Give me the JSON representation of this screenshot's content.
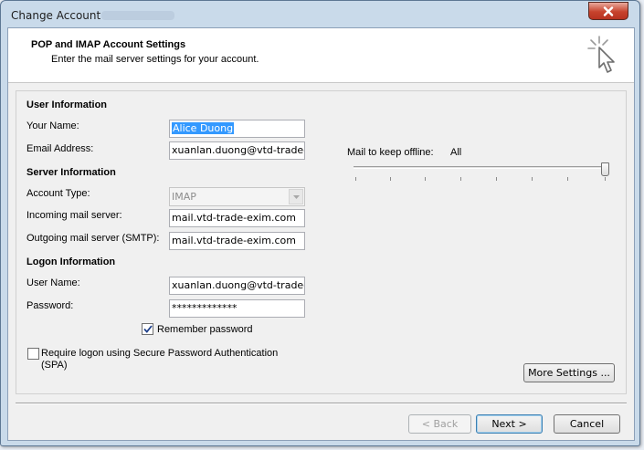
{
  "window": {
    "title": "Change Account",
    "close_icon": "close-icon"
  },
  "header": {
    "title": "POP and IMAP Account Settings",
    "subtitle": "Enter the mail server settings for your account.",
    "icon": "wizard-cursor-icon"
  },
  "user_info": {
    "section_label": "User Information",
    "name_label": "Your Name:",
    "name_value": "Alice Duong",
    "email_label": "Email Address:",
    "email_value": "xuanlan.duong@vtd-trade-e"
  },
  "server_info": {
    "section_label": "Server Information",
    "account_type_label": "Account Type:",
    "account_type_value": "IMAP",
    "incoming_label": "Incoming mail server:",
    "incoming_value": "mail.vtd-trade-exim.com",
    "outgoing_label": "Outgoing mail server (SMTP):",
    "outgoing_value": "mail.vtd-trade-exim.com"
  },
  "logon_info": {
    "section_label": "Logon Information",
    "username_label": "User Name:",
    "username_value": "xuanlan.duong@vtd-trade-e",
    "password_label": "Password:",
    "password_value": "*************",
    "remember_label": "Remember password",
    "remember_checked": true,
    "spa_label_line1": "Require logon using Secure Password Authentication",
    "spa_label_line2": "(SPA)",
    "spa_checked": false
  },
  "offline": {
    "label": "Mail to keep offline:",
    "value": "All",
    "level_fraction": 1.0
  },
  "buttons": {
    "more_settings": "More Settings ...",
    "back": "< Back",
    "next": "Next >",
    "cancel": "Cancel"
  }
}
